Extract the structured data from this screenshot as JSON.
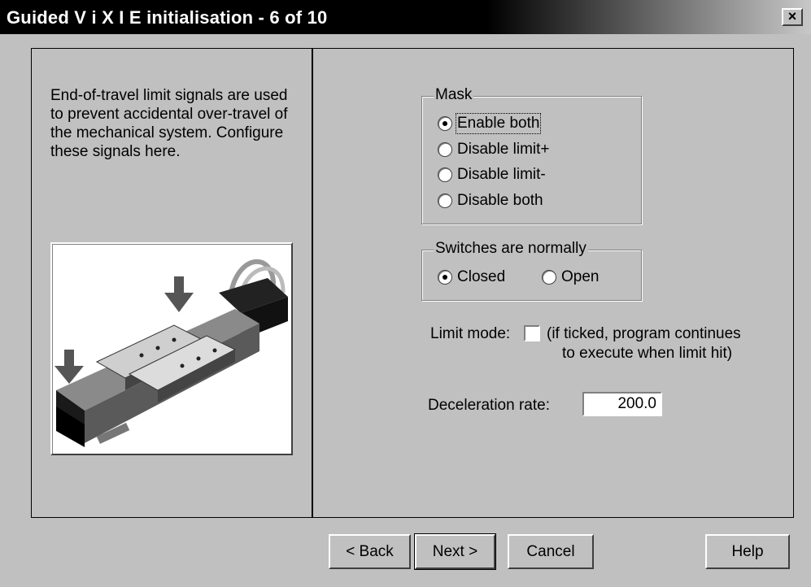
{
  "window": {
    "title": "Guided V i X I E initialisation - 6 of 10",
    "close_glyph": "×"
  },
  "description": "End-of-travel limit signals are used to prevent accidental over-travel of the mechanical system. Configure these signals here.",
  "mask": {
    "label": "Mask",
    "options": [
      {
        "label": "Enable both",
        "checked": true
      },
      {
        "label": "Disable limit+",
        "checked": false
      },
      {
        "label": "Disable limit-",
        "checked": false
      },
      {
        "label": "Disable both",
        "checked": false
      }
    ]
  },
  "switches": {
    "label": "Switches are normally",
    "options": [
      {
        "label": "Closed",
        "checked": true
      },
      {
        "label": "Open",
        "checked": false
      }
    ]
  },
  "limit_mode": {
    "label": "Limit mode:",
    "checked": false,
    "hint_line1": "(if ticked, program continues",
    "hint_line2": "to execute when limit hit)"
  },
  "deceleration": {
    "label": "Deceleration rate:",
    "value": "200.0"
  },
  "buttons": {
    "back": "< Back",
    "next": "Next >",
    "cancel": "Cancel",
    "help": "Help"
  },
  "icons": [
    "close-icon",
    "linear-stage-image",
    "down-arrow-icon"
  ]
}
